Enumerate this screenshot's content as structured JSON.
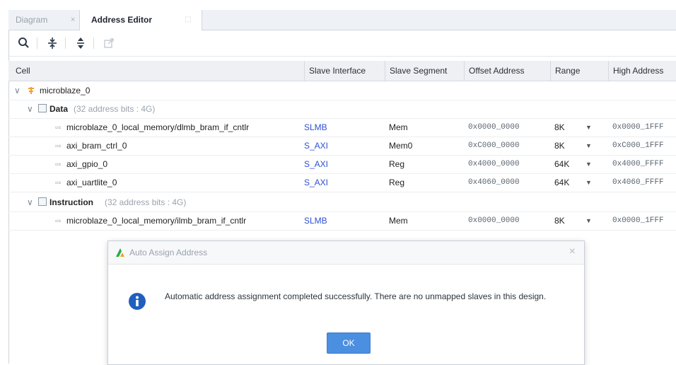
{
  "tabs": {
    "diagram": "Diagram",
    "diagram_close": "×",
    "address_editor": "Address Editor",
    "address_editor_ext": "⬚"
  },
  "toolbar": {
    "icons": [
      "search-icon",
      "collapse-all-icon",
      "expand-all-icon",
      "auto-assign-icon"
    ]
  },
  "columns": {
    "cell": "Cell",
    "slave_interface": "Slave Interface",
    "slave_segment": "Slave Segment",
    "offset_address": "Offset Address",
    "range": "Range",
    "high_address": "High Address"
  },
  "tree": {
    "root": {
      "toggle": "∨",
      "label": "microblaze_0"
    },
    "data_group": {
      "toggle": "∨",
      "label": "Data",
      "detail": "(32 address bits : 4G)"
    },
    "instruction_group": {
      "toggle": "∨",
      "label": "Instruction",
      "detail": "(32 address bits : 4G)"
    }
  },
  "rows": [
    {
      "name": "microblaze_0_local_memory/dlmb_bram_if_cntlr",
      "interface": "SLMB",
      "segment": "Mem",
      "offset": "0x0000_0000",
      "range": "8K",
      "high": "0x0000_1FFF"
    },
    {
      "name": "axi_bram_ctrl_0",
      "interface": "S_AXI",
      "segment": "Mem0",
      "offset": "0xC000_0000",
      "range": "8K",
      "high": "0xC000_1FFF"
    },
    {
      "name": "axi_gpio_0",
      "interface": "S_AXI",
      "segment": "Reg",
      "offset": "0x4000_0000",
      "range": "64K",
      "high": "0x4000_FFFF"
    },
    {
      "name": "axi_uartlite_0",
      "interface": "S_AXI",
      "segment": "Reg",
      "offset": "0x4060_0000",
      "range": "64K",
      "high": "0x4060_FFFF"
    }
  ],
  "instruction_rows": [
    {
      "name": "microblaze_0_local_memory/ilmb_bram_if_cntlr",
      "interface": "SLMB",
      "segment": "Mem",
      "offset": "0x0000_0000",
      "range": "8K",
      "high": "0x0000_1FFF"
    }
  ],
  "row_prefix": "▫▫",
  "range_dropdown": "▼",
  "dialog": {
    "title": "Auto Assign Address",
    "close": "×",
    "message": "Automatic address assignment completed successfully. There are no unmapped slaves in this design.",
    "ok": "OK"
  },
  "colors": {
    "accent": "#4b8fe0",
    "info_icon": "#1f5fbf",
    "link_blue": "#2e4fd6",
    "processor_icon": "#f0a030"
  }
}
